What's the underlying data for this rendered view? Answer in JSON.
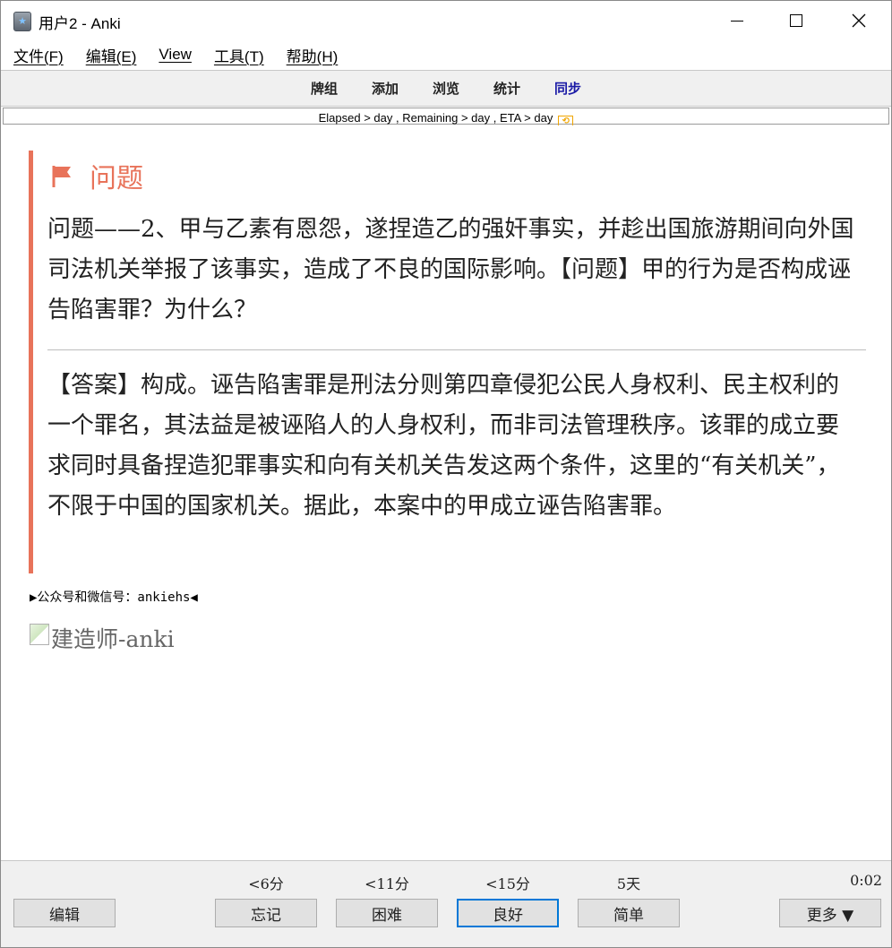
{
  "window": {
    "title": "用户2 - Anki"
  },
  "menubar": {
    "items": [
      "文件(F)",
      "编辑(E)",
      "View",
      "工具(T)",
      "帮助(H)"
    ]
  },
  "toolbar": {
    "items": [
      "牌组",
      "添加",
      "浏览",
      "统计",
      "同步"
    ]
  },
  "progress": {
    "text": "Elapsed > day , Remaining > day , ETA > day",
    "icon": "refresh-icon"
  },
  "card": {
    "question_title": "问题",
    "question_body": "问题——2、甲与乙素有恩怨，遂捏造乙的强奸事实，并趁出国旅游期间向外国司法机关举报了该事实，造成了不良的国际影响。【问题】甲的行为是否构成诬告陷害罪？为什么？",
    "answer_body": "【答案】构成。诬告陷害罪是刑法分则第四章侵犯公民人身权利、民主权利的一个罪名，其法益是被诬陷人的人身权利，而非司法管理秩序。该罪的成立要求同时具备捏造犯罪事实和向有关机关告发这两个条件，这里的“有关机关”，不限于中国的国家机关。据此，本案中的甲成立诬告陷害罪。",
    "wechat_line": "▶公众号和微信号：ankiehs◀",
    "image_alt": "建造师-anki",
    "accent_color": "#e8735a"
  },
  "bottom": {
    "edit_label": "编辑",
    "more_label": "更多 ▼",
    "timer": "0:02",
    "answers": [
      {
        "interval": "<6分",
        "label": "忘记"
      },
      {
        "interval": "<11分",
        "label": "困难"
      },
      {
        "interval": "<15分",
        "label": "良好"
      },
      {
        "interval": "5天",
        "label": "简单"
      }
    ]
  }
}
